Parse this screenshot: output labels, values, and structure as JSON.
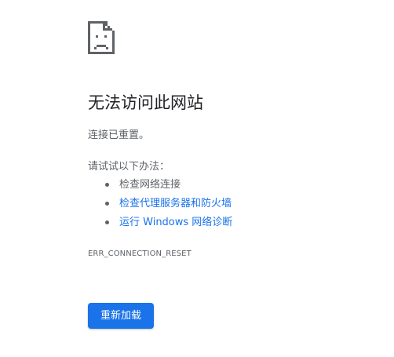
{
  "error_page": {
    "icon": "sad-page-icon",
    "title": "无法访问此网站",
    "message": "连接已重置。",
    "suggestions_heading": "请试试以下办法：",
    "suggestions": [
      {
        "label": "检查网络连接",
        "is_link": false
      },
      {
        "label": "检查代理服务器和防火墙",
        "is_link": true
      },
      {
        "label": "运行 Windows 网络诊断",
        "is_link": true
      }
    ],
    "error_code": "ERR_CONNECTION_RESET",
    "reload_button_label": "重新加载"
  },
  "colors": {
    "title_text": "#202124",
    "secondary_text": "#5f6368",
    "link": "#1a73e8",
    "button_background": "#1a73e8",
    "button_text": "#ffffff",
    "background": "#ffffff"
  }
}
